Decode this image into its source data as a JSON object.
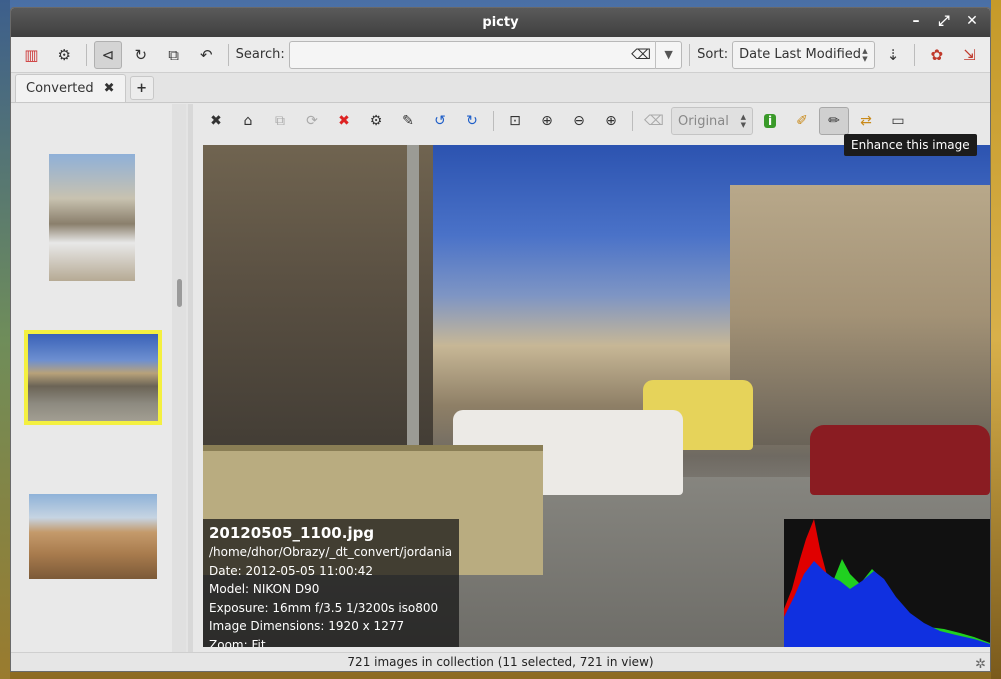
{
  "window": {
    "title": "picty",
    "controls": {
      "minimize": "–",
      "maximize": "⤢",
      "close": "✕"
    }
  },
  "toolbar": {
    "search_label": "Search:",
    "search_value": "",
    "search_placeholder": "",
    "sort_label": "Sort:",
    "sort_value": "Date Last Modified",
    "icons": {
      "sidebar": "▥",
      "settings": "⚙",
      "view_toggle": "⊲",
      "rotate": "↻",
      "select": "⧉",
      "undo": "↶",
      "clear": "⌫",
      "dropdown": "▼",
      "sort_direction": "⇣",
      "plugin": "✿",
      "exit": "⇲"
    }
  },
  "tabs": [
    {
      "label": "Converted",
      "close": "✖"
    }
  ],
  "tab_add": "+",
  "viewer_toolbar": {
    "zoom_value": "Original",
    "icons": {
      "close": "✖",
      "home": "⌂",
      "copy": "⧉",
      "rotate_copy": "⟳",
      "delete": "✖",
      "settings": "⚙",
      "edit": "✎",
      "rotate_left": "↺",
      "rotate_right": "↻",
      "fit": "⊡",
      "zoom_in_one": "⊕",
      "zoom_out": "⊖",
      "zoom_in": "⊕",
      "clear": "⌫",
      "info": "i",
      "tag": "✐",
      "enhance": "✏",
      "transfer": "⇄",
      "fullscreen": "▭"
    }
  },
  "tooltip": "Enhance this image",
  "image_info": {
    "filename": "20120505_1100.jpg",
    "path": "/home/dhor/Obrazy/_dt_convert/jordania",
    "date": "Date: 2012-05-05 11:00:42",
    "model": "Model: NIKON D90",
    "exposure": "Exposure: 16mm f/3.5 1/3200s iso800",
    "dimensions": "Image Dimensions: 1920 x 1277",
    "zoom": "Zoom: Fit"
  },
  "status": {
    "text": "721 images in collection (11 selected, 721 in view)",
    "busy_icon": "✲"
  },
  "colors": {
    "titlebar": "#3f3f3f",
    "selection": "#f4f040",
    "histogram_red": "#e00000",
    "histogram_green": "#20d020",
    "histogram_blue": "#1030e0"
  }
}
